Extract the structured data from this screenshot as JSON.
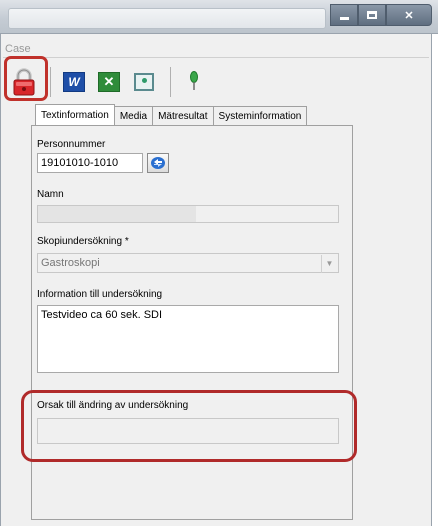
{
  "window": {
    "title": "",
    "case_label": "Case"
  },
  "tabs": [
    {
      "label": "Textinformation"
    },
    {
      "label": "Media"
    },
    {
      "label": "Mätresultat"
    },
    {
      "label": "Systeminformation"
    }
  ],
  "form": {
    "personnummer_label": "Personnummer",
    "personnummer_value": "19101010-1010",
    "namn_label": "Namn",
    "namn_value": "",
    "skopi_label": "Skopiundersökning *",
    "skopi_value": "Gastroskopi",
    "info_label": "Information till undersökning",
    "info_value": "Testvideo ca 60 sek. SDI",
    "reason_label": "Orsak till ändring av undersökning",
    "reason_value": ""
  },
  "icons": {
    "lock": "lock-icon",
    "word": "word-icon",
    "excel": "excel-icon",
    "presentation": "presentation-icon",
    "pin": "pin-icon"
  }
}
